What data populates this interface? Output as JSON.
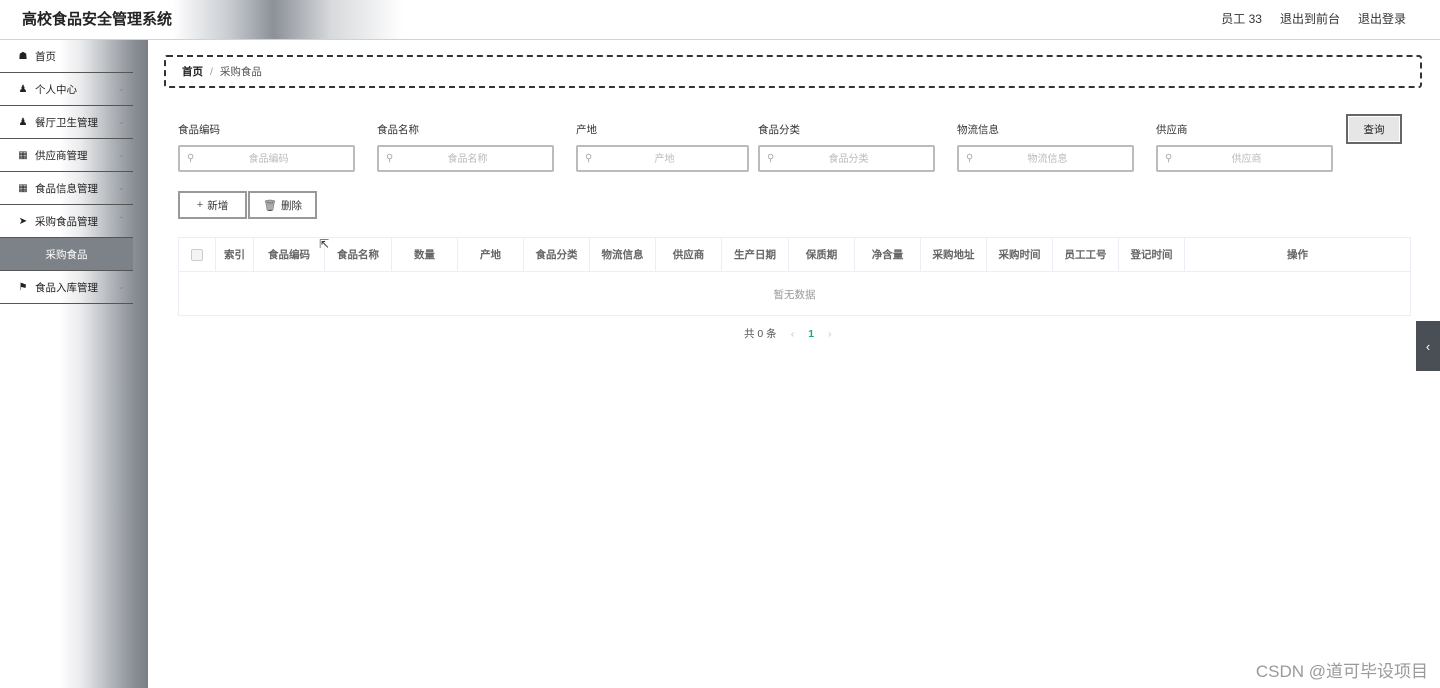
{
  "header": {
    "app_title": "高校食品安全管理系统",
    "user": "员工 33",
    "exit_front": "退出到前台",
    "logout": "退出登录"
  },
  "sidebar": {
    "items": [
      {
        "label": "首页",
        "icon": "home-icon",
        "chev": false
      },
      {
        "label": "个人中心",
        "icon": "user-icon",
        "chev": true
      },
      {
        "label": "餐厅卫生管理",
        "icon": "user-icon",
        "chev": true
      },
      {
        "label": "供应商管理",
        "icon": "grid-icon",
        "chev": true
      },
      {
        "label": "食品信息管理",
        "icon": "grid-icon",
        "chev": true
      },
      {
        "label": "采购食品管理",
        "icon": "send-icon",
        "chev": true
      },
      {
        "label": "采购食品",
        "submenu": true
      },
      {
        "label": "食品入库管理",
        "icon": "flag-icon",
        "chev": true
      }
    ]
  },
  "breadcrumb": {
    "home": "首页",
    "separator": "/",
    "current": "采购食品"
  },
  "search": {
    "fields": [
      {
        "label": "食品编码",
        "placeholder": "食品编码"
      },
      {
        "label": "食品名称",
        "placeholder": "食品名称"
      },
      {
        "label": "产地",
        "placeholder": "产地"
      },
      {
        "label": "食品分类",
        "placeholder": "食品分类"
      },
      {
        "label": "物流信息",
        "placeholder": "物流信息"
      },
      {
        "label": "供应商",
        "placeholder": "供应商"
      }
    ],
    "query_label": "查询"
  },
  "actions": {
    "add_label": "新增",
    "delete_label": "删除"
  },
  "table": {
    "columns": [
      "索引",
      "食品编码",
      "食品名称",
      "数量",
      "产地",
      "食品分类",
      "物流信息",
      "供应商",
      "生产日期",
      "保质期",
      "净含量",
      "采购地址",
      "采购时间",
      "员工工号",
      "登记时间",
      "操作"
    ],
    "empty_text": "暂无数据"
  },
  "pagination": {
    "total_text": "共 0 条",
    "current_page": "1"
  },
  "watermark": "CSDN @道可毕设项目"
}
